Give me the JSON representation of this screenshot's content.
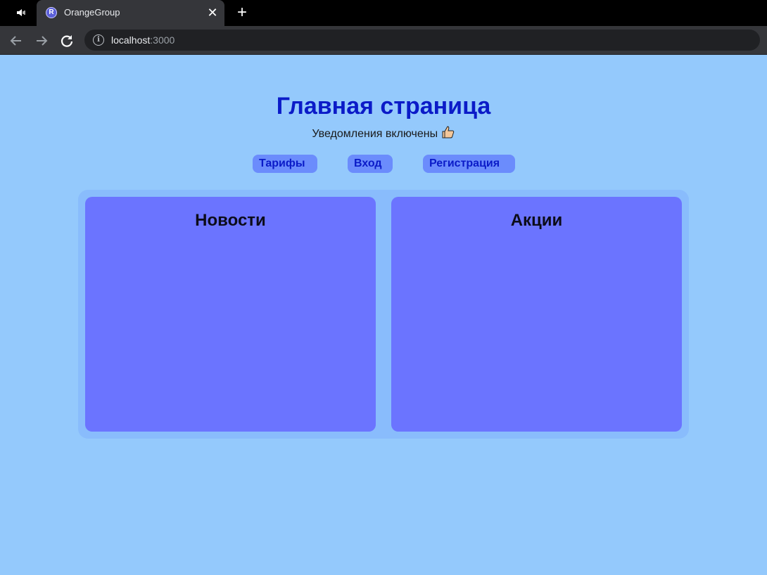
{
  "browser": {
    "tab_title": "OrangeGroup",
    "favicon_letter": "R",
    "url_host": "localhost",
    "url_port": ":3000"
  },
  "page": {
    "title": "Главная страница",
    "subtitle": "Уведомления включены",
    "nav": [
      {
        "label": "Тарифы"
      },
      {
        "label": "Вход"
      },
      {
        "label": "Регистрация"
      }
    ],
    "cards": [
      {
        "title": "Новости"
      },
      {
        "title": "Акции"
      }
    ]
  },
  "colors": {
    "background": "#94c9fc",
    "title": "#0b1bc8",
    "card": "#6b74ff",
    "nav_button": "#6b8cfc"
  },
  "icons": [
    "mute-icon",
    "close-icon",
    "plus-icon",
    "back-arrow-icon",
    "forward-arrow-icon",
    "reload-icon",
    "info-icon",
    "thumbs-up-icon"
  ]
}
